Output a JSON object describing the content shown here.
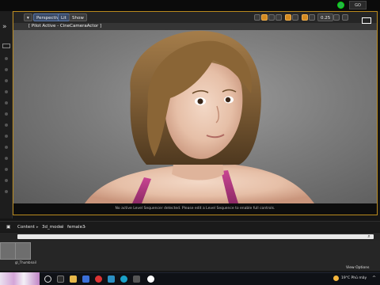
{
  "viewport": {
    "perspective_label": "Perspective",
    "lit_label": "Lit",
    "show_label": "Show",
    "pilot_text": "[ Pilot Active - CineCameraActor ]",
    "footer_message": "No active Level Sequencer detected. Please edit a Level Sequence to enable full controls.",
    "right_tools_value": "0.25"
  },
  "content_browser": {
    "content_label": "Content",
    "crumbs": [
      "3d_model",
      "female3"
    ],
    "asset_label": "gl_Thumbnail",
    "view_options_label": "View Options"
  },
  "topbar": {
    "cta_label": "GO"
  },
  "taskbar": {
    "weather_text": "19°C  Phủ mây"
  },
  "colors": {
    "viewport_border": "#b98a1e",
    "accent_orange": "#d48a21",
    "status_green": "#27b24a"
  }
}
